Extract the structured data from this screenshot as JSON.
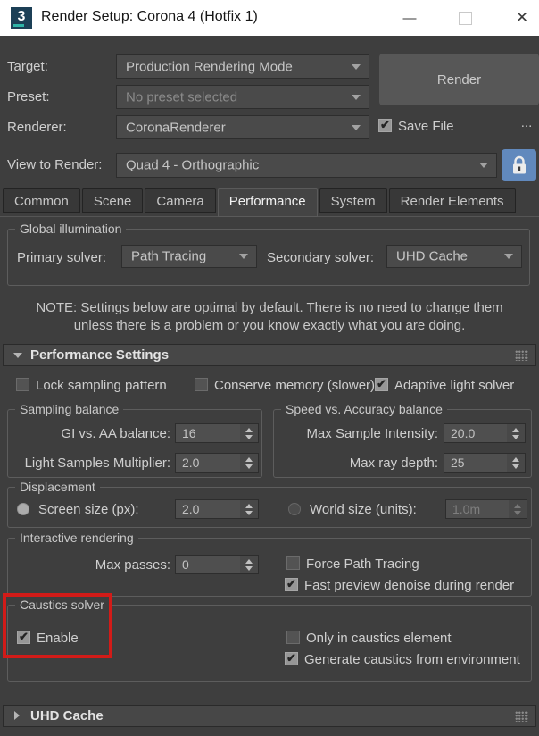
{
  "colors": {
    "background": "#3e3e3e",
    "titlebar": "#ffffff",
    "accent_blue": "#6189bd",
    "highlight_red": "#d21b18"
  },
  "window": {
    "title": "Render Setup: Corona 4 (Hotfix 1)",
    "app_icon_glyph": "3",
    "minimize_glyph": "—",
    "close_glyph": "✕"
  },
  "toolbar": {
    "target_label": "Target:",
    "target_value": "Production Rendering Mode",
    "preset_label": "Preset:",
    "preset_value": "No preset selected",
    "renderer_label": "Renderer:",
    "renderer_value": "CoronaRenderer",
    "render_button": "Render",
    "save_file_label": "Save File",
    "save_file_checked": true,
    "browse_button": "...",
    "view_label": "View to Render:",
    "view_value": "Quad 4 - Orthographic"
  },
  "tabs": {
    "items": [
      "Common",
      "Scene",
      "Camera",
      "Performance",
      "System",
      "Render Elements"
    ],
    "active": "Performance"
  },
  "gi": {
    "title": "Global illumination",
    "primary_label": "Primary solver:",
    "primary_value": "Path Tracing",
    "secondary_label": "Secondary solver:",
    "secondary_value": "UHD Cache"
  },
  "note": {
    "line1": "NOTE: Settings below are optimal by default. There is no need to change them",
    "line2": "unless there is a problem or you know exactly what you are doing."
  },
  "performance": {
    "title": "Performance Settings",
    "lock_sampling": {
      "label": "Lock sampling pattern",
      "checked": false
    },
    "conserve_memory": {
      "label": "Conserve memory (slower)",
      "checked": false
    },
    "adaptive_light": {
      "label": "Adaptive light solver",
      "checked": true
    },
    "sampling_balance": {
      "title": "Sampling balance",
      "gi_aa_label": "GI vs. AA balance:",
      "gi_aa_value": "16",
      "light_samples_label": "Light Samples Multiplier:",
      "light_samples_value": "2.0"
    },
    "speed_accuracy": {
      "title": "Speed vs. Accuracy balance",
      "max_intensity_label": "Max Sample Intensity:",
      "max_intensity_value": "20.0",
      "max_ray_label": "Max ray depth:",
      "max_ray_value": "25"
    },
    "displacement": {
      "title": "Displacement",
      "screen_label": "Screen size (px):",
      "screen_value": "2.0",
      "screen_selected": true,
      "world_label": "World size (units):",
      "world_value": "1.0m",
      "world_selected": false
    },
    "interactive": {
      "title": "Interactive rendering",
      "max_passes_label": "Max passes:",
      "max_passes_value": "0",
      "force_pt": {
        "label": "Force Path Tracing",
        "checked": false
      },
      "fast_denoise": {
        "label": "Fast preview denoise during render",
        "checked": true
      }
    },
    "caustics": {
      "title": "Caustics solver",
      "enable": {
        "label": "Enable",
        "checked": true
      },
      "only_element": {
        "label": "Only in caustics element",
        "checked": false
      },
      "generate_env": {
        "label": "Generate caustics from environment",
        "checked": true
      }
    }
  },
  "uhd_cache": {
    "title": "UHD Cache"
  }
}
